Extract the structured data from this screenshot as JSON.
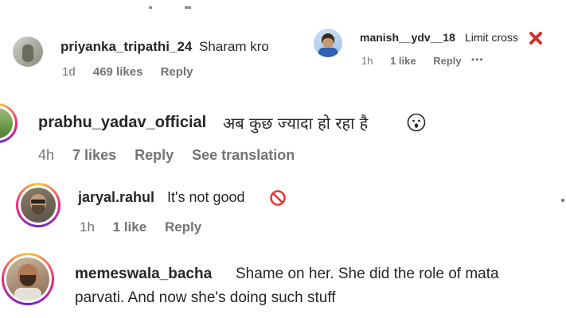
{
  "comments": [
    {
      "username": "priyanka_tripathi_24",
      "text": "Sharam kro",
      "time": "1d",
      "likes": "469 likes",
      "reply": "Reply"
    },
    {
      "username": "manish__ydv__18",
      "text": "Limit cross",
      "time": "1h",
      "likes": "1 like",
      "reply": "Reply",
      "more": "•••"
    },
    {
      "username": "prabhu_yadav_official",
      "text": "अब कुछ ज्यादा हो रहा है",
      "time": "4h",
      "likes": "7 likes",
      "reply": "Reply",
      "translate": "See translation"
    },
    {
      "username": "jaryal.rahul",
      "text": "It's not good",
      "time": "1h",
      "likes": "1 like",
      "reply": "Reply"
    },
    {
      "username": "memeswala_bacha",
      "text_line1": "Shame on her. She did the role of mata",
      "text_line2": "parvati. And now she's doing such stuff"
    }
  ],
  "icons": {
    "cross_mark": "cross-mark-emoji",
    "surprised": "surprised-face-emoji",
    "prohibited": "prohibited-emoji"
  },
  "colors": {
    "text": "#262626",
    "meta": "#737373",
    "cross_red": "#d32f2f"
  }
}
